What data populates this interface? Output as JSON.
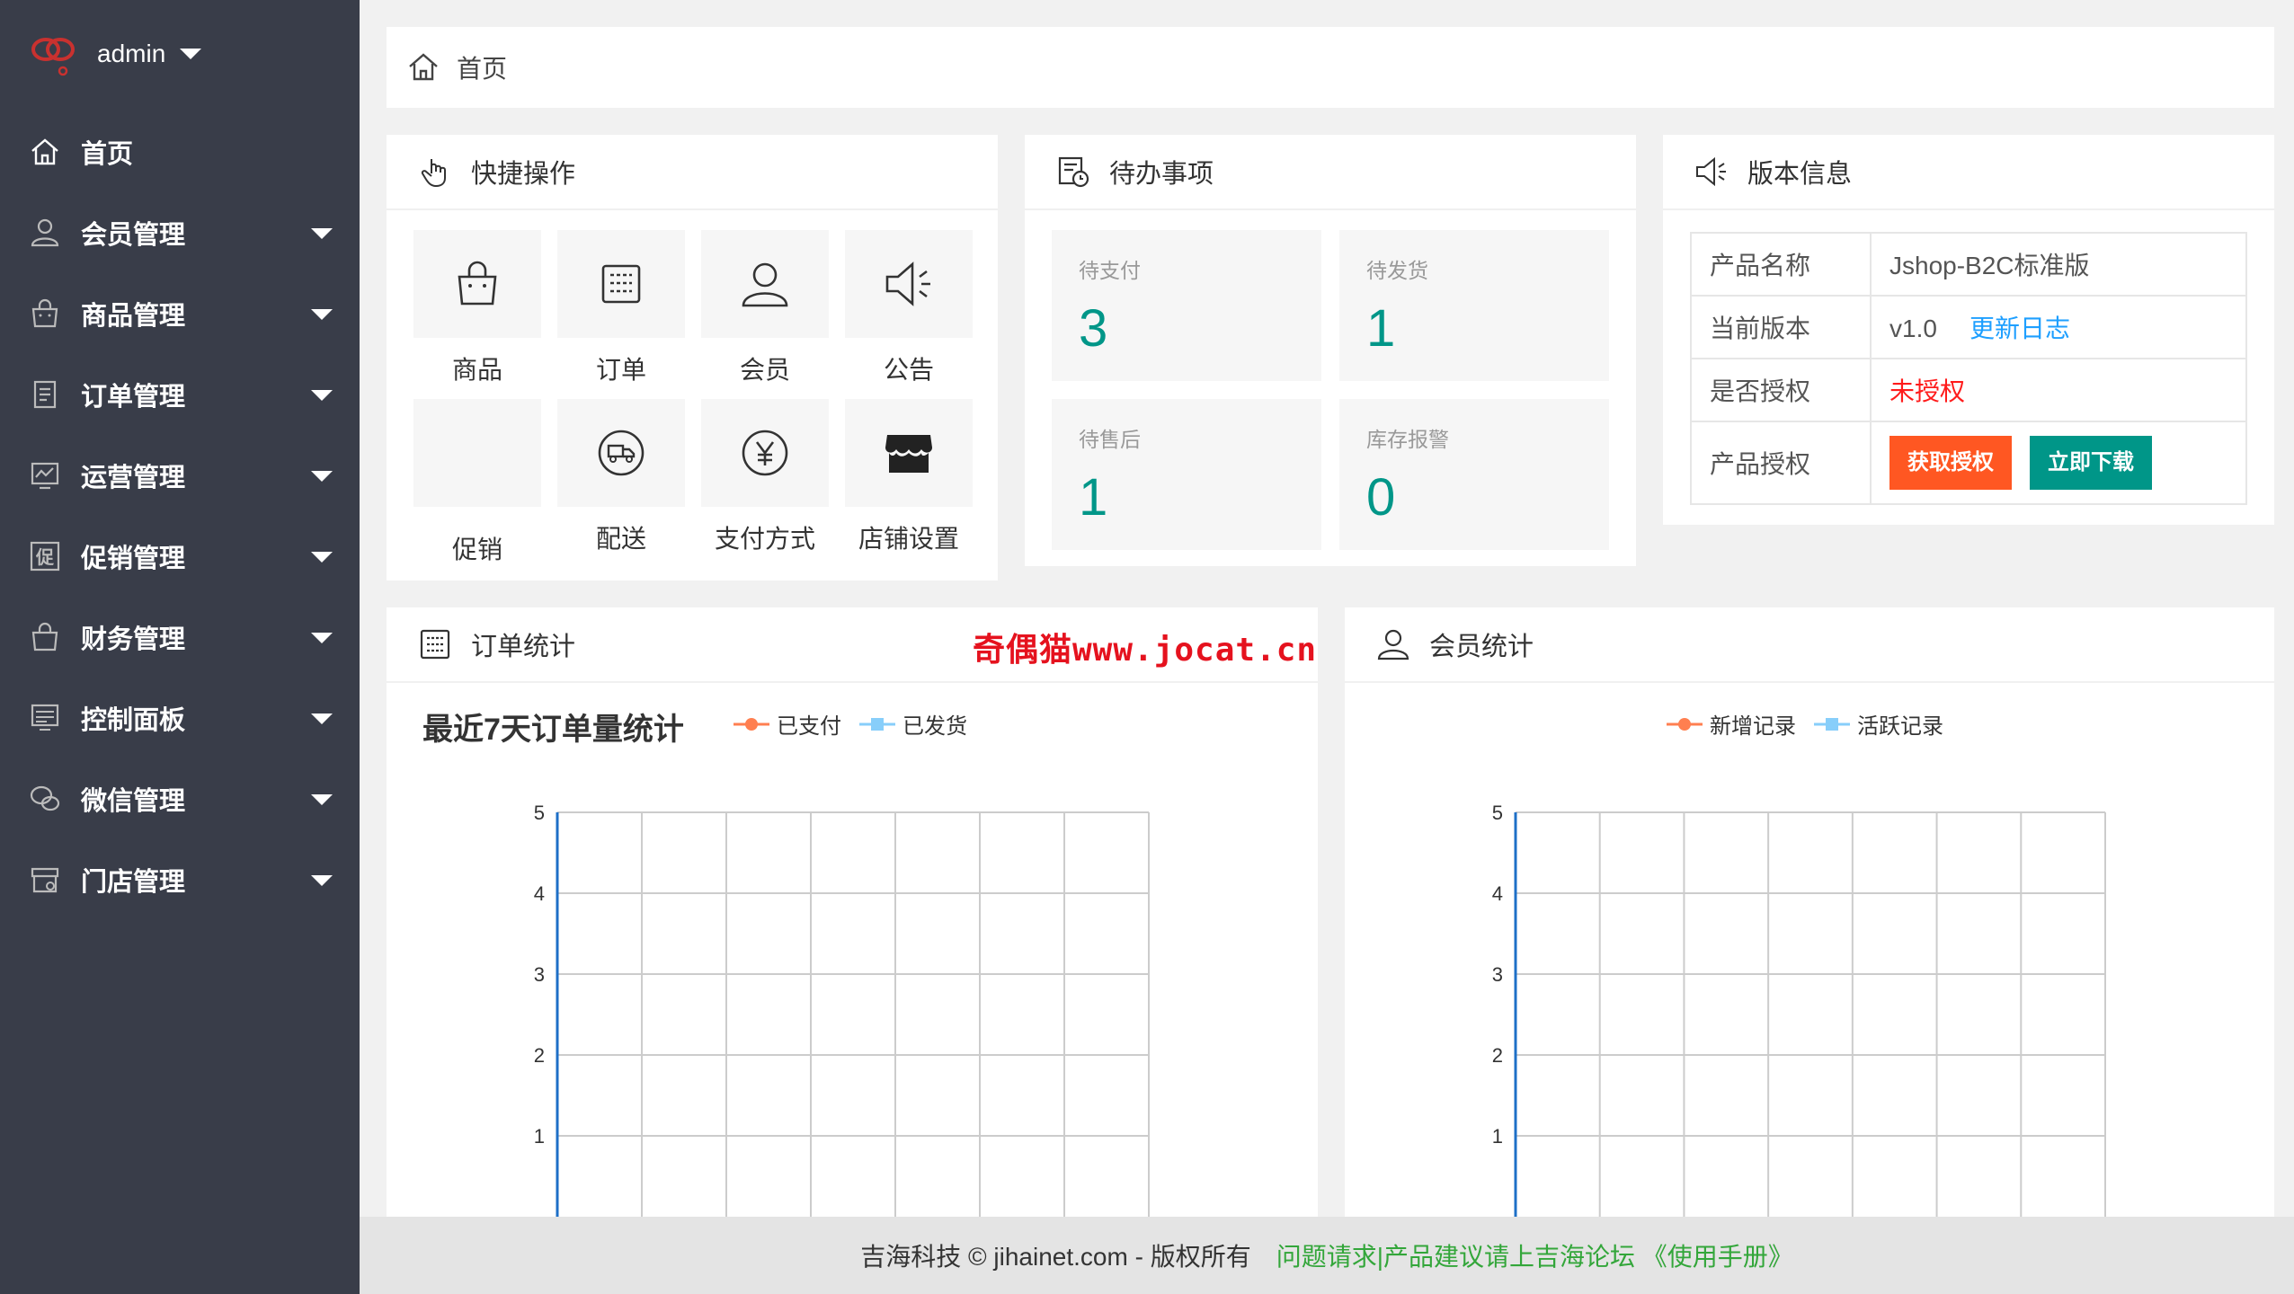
{
  "sidebar": {
    "user": "admin",
    "items": [
      {
        "label": "首页",
        "icon": "home-icon",
        "has_children": false
      },
      {
        "label": "会员管理",
        "icon": "user-icon",
        "has_children": true
      },
      {
        "label": "商品管理",
        "icon": "bag-icon",
        "has_children": true
      },
      {
        "label": "订单管理",
        "icon": "order-list-icon",
        "has_children": true
      },
      {
        "label": "运营管理",
        "icon": "chart-monitor-icon",
        "has_children": true
      },
      {
        "label": "促销管理",
        "icon": "promo-icon",
        "has_children": true
      },
      {
        "label": "财务管理",
        "icon": "wallet-icon",
        "has_children": true
      },
      {
        "label": "控制面板",
        "icon": "panel-icon",
        "has_children": true
      },
      {
        "label": "微信管理",
        "icon": "wechat-icon",
        "has_children": true
      },
      {
        "label": "门店管理",
        "icon": "store-icon",
        "has_children": true
      }
    ]
  },
  "breadcrumb": {
    "home": "首页"
  },
  "quick": {
    "title": "快捷操作",
    "items": [
      {
        "label": "商品",
        "icon": "bag-icon"
      },
      {
        "label": "订单",
        "icon": "order-icon"
      },
      {
        "label": "会员",
        "icon": "user-icon"
      },
      {
        "label": "公告",
        "icon": "megaphone-icon"
      },
      {
        "label": "促销",
        "icon": "promo-blank-icon"
      },
      {
        "label": "配送",
        "icon": "truck-icon"
      },
      {
        "label": "支付方式",
        "icon": "yen-icon"
      },
      {
        "label": "店铺设置",
        "icon": "shop-icon"
      }
    ]
  },
  "todo": {
    "title": "待办事项",
    "items": [
      {
        "label": "待支付",
        "value": "3"
      },
      {
        "label": "待发货",
        "value": "1"
      },
      {
        "label": "待售后",
        "value": "1"
      },
      {
        "label": "库存报警",
        "value": "0"
      }
    ]
  },
  "version": {
    "title": "版本信息",
    "rows": {
      "name_key": "产品名称",
      "name_val": "Jshop-B2C标准版",
      "ver_key": "当前版本",
      "ver_val": "v1.0",
      "changelog": "更新日志",
      "auth_key": "是否授权",
      "auth_val": "未授权",
      "license_key": "产品授权",
      "get_license": "获取授权",
      "download": "立即下载"
    }
  },
  "order_stats": {
    "title": "订单统计",
    "watermark": "奇偶猫www.jocat.cn",
    "chart_title": "最近7天订单量统计",
    "legend": [
      "已支付",
      "已发货"
    ]
  },
  "member_stats": {
    "title": "会员统计",
    "legend": [
      "新增记录",
      "活跃记录"
    ]
  },
  "chart_data": [
    {
      "type": "line",
      "title": "最近7天订单量统计",
      "series": [
        {
          "name": "已支付",
          "values": []
        },
        {
          "name": "已发货",
          "values": []
        }
      ],
      "y_ticks": [
        "1",
        "2",
        "3",
        "4",
        "5"
      ],
      "ylim": [
        0,
        5
      ],
      "grid": true,
      "colors": {
        "已支付": "#ff7f50",
        "已发货": "#87cefa"
      }
    },
    {
      "type": "line",
      "title": "",
      "series": [
        {
          "name": "新增记录",
          "values": []
        },
        {
          "name": "活跃记录",
          "values": []
        }
      ],
      "y_ticks": [
        "1",
        "2",
        "3",
        "4",
        "5"
      ],
      "ylim": [
        0,
        5
      ],
      "grid": true,
      "colors": {
        "新增记录": "#ff7f50",
        "活跃记录": "#87cefa"
      }
    }
  ],
  "footer": {
    "copyright": "吉海科技 © jihainet.com - 版权所有",
    "links": "问题请求|产品建议请上吉海论坛 《使用手册》"
  }
}
